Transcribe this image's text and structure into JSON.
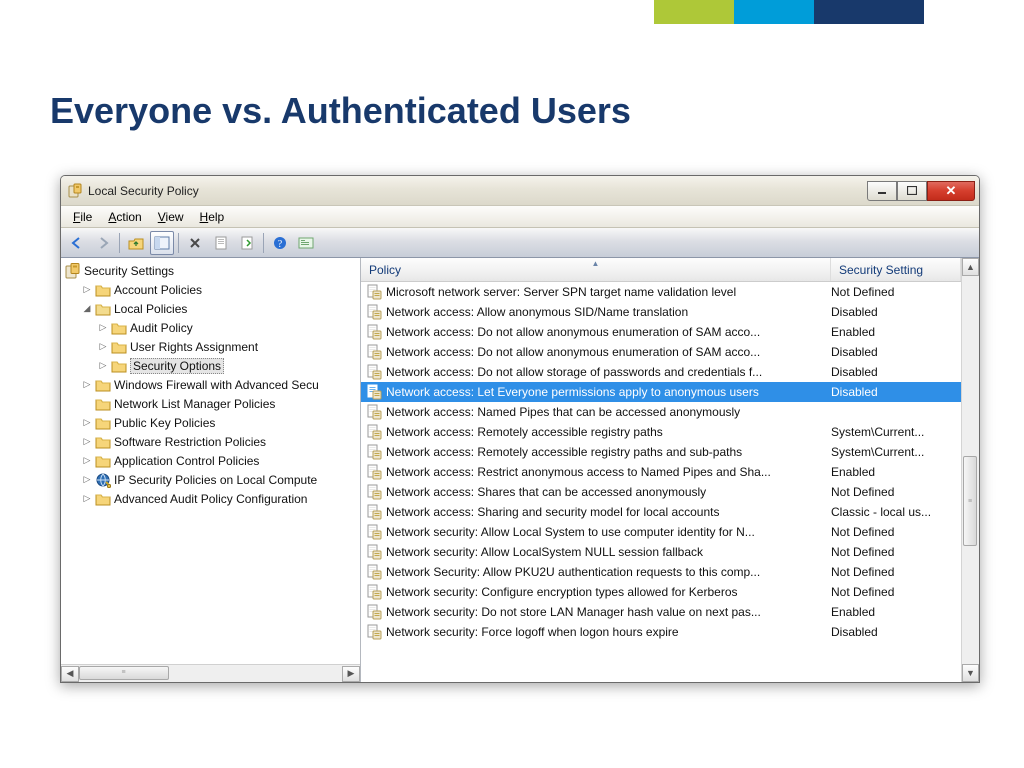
{
  "slide": {
    "title": "Everyone vs. Authenticated Users"
  },
  "window": {
    "title": "Local Security Policy",
    "menu": {
      "file": "File",
      "action": "Action",
      "view": "View",
      "help": "Help"
    },
    "columns": {
      "policy": "Policy",
      "setting": "Security Setting"
    },
    "tree": {
      "root": "Security Settings",
      "items": [
        {
          "label": "Account Policies",
          "indent": 1,
          "exp": "▷"
        },
        {
          "label": "Local Policies",
          "indent": 1,
          "exp": "◢"
        },
        {
          "label": "Audit Policy",
          "indent": 2,
          "exp": "▷"
        },
        {
          "label": "User Rights Assignment",
          "indent": 2,
          "exp": "▷"
        },
        {
          "label": "Security Options",
          "indent": 2,
          "exp": "▷",
          "selected": true
        },
        {
          "label": "Windows Firewall with Advanced Secu",
          "indent": 1,
          "exp": "▷"
        },
        {
          "label": "Network List Manager Policies",
          "indent": 1,
          "exp": ""
        },
        {
          "label": "Public Key Policies",
          "indent": 1,
          "exp": "▷"
        },
        {
          "label": "Software Restriction Policies",
          "indent": 1,
          "exp": "▷"
        },
        {
          "label": "Application Control Policies",
          "indent": 1,
          "exp": "▷"
        },
        {
          "label": "IP Security Policies on Local Compute",
          "indent": 1,
          "exp": "▷",
          "icon": "ipsec"
        },
        {
          "label": "Advanced Audit Policy Configuration",
          "indent": 1,
          "exp": "▷"
        }
      ]
    },
    "policies": [
      {
        "name": "Microsoft network server: Server SPN target name validation level",
        "value": "Not Defined"
      },
      {
        "name": "Network access: Allow anonymous SID/Name translation",
        "value": "Disabled"
      },
      {
        "name": "Network access: Do not allow anonymous enumeration of SAM acco...",
        "value": "Enabled"
      },
      {
        "name": "Network access: Do not allow anonymous enumeration of SAM acco...",
        "value": "Disabled"
      },
      {
        "name": "Network access: Do not allow storage of passwords and credentials f...",
        "value": "Disabled"
      },
      {
        "name": "Network access: Let Everyone permissions apply to anonymous users",
        "value": "Disabled",
        "selected": true
      },
      {
        "name": "Network access: Named Pipes that can be accessed anonymously",
        "value": ""
      },
      {
        "name": "Network access: Remotely accessible registry paths",
        "value": "System\\Current..."
      },
      {
        "name": "Network access: Remotely accessible registry paths and sub-paths",
        "value": "System\\Current..."
      },
      {
        "name": "Network access: Restrict anonymous access to Named Pipes and Sha...",
        "value": "Enabled"
      },
      {
        "name": "Network access: Shares that can be accessed anonymously",
        "value": "Not Defined"
      },
      {
        "name": "Network access: Sharing and security model for local accounts",
        "value": "Classic - local us..."
      },
      {
        "name": "Network security: Allow Local System to use computer identity for N...",
        "value": "Not Defined"
      },
      {
        "name": "Network security: Allow LocalSystem NULL session fallback",
        "value": "Not Defined"
      },
      {
        "name": "Network Security: Allow PKU2U authentication requests to this comp...",
        "value": "Not Defined"
      },
      {
        "name": "Network security: Configure encryption types allowed for Kerberos",
        "value": "Not Defined"
      },
      {
        "name": "Network security: Do not store LAN Manager hash value on next pas...",
        "value": "Enabled"
      },
      {
        "name": "Network security: Force logoff when logon hours expire",
        "value": "Disabled"
      }
    ]
  }
}
